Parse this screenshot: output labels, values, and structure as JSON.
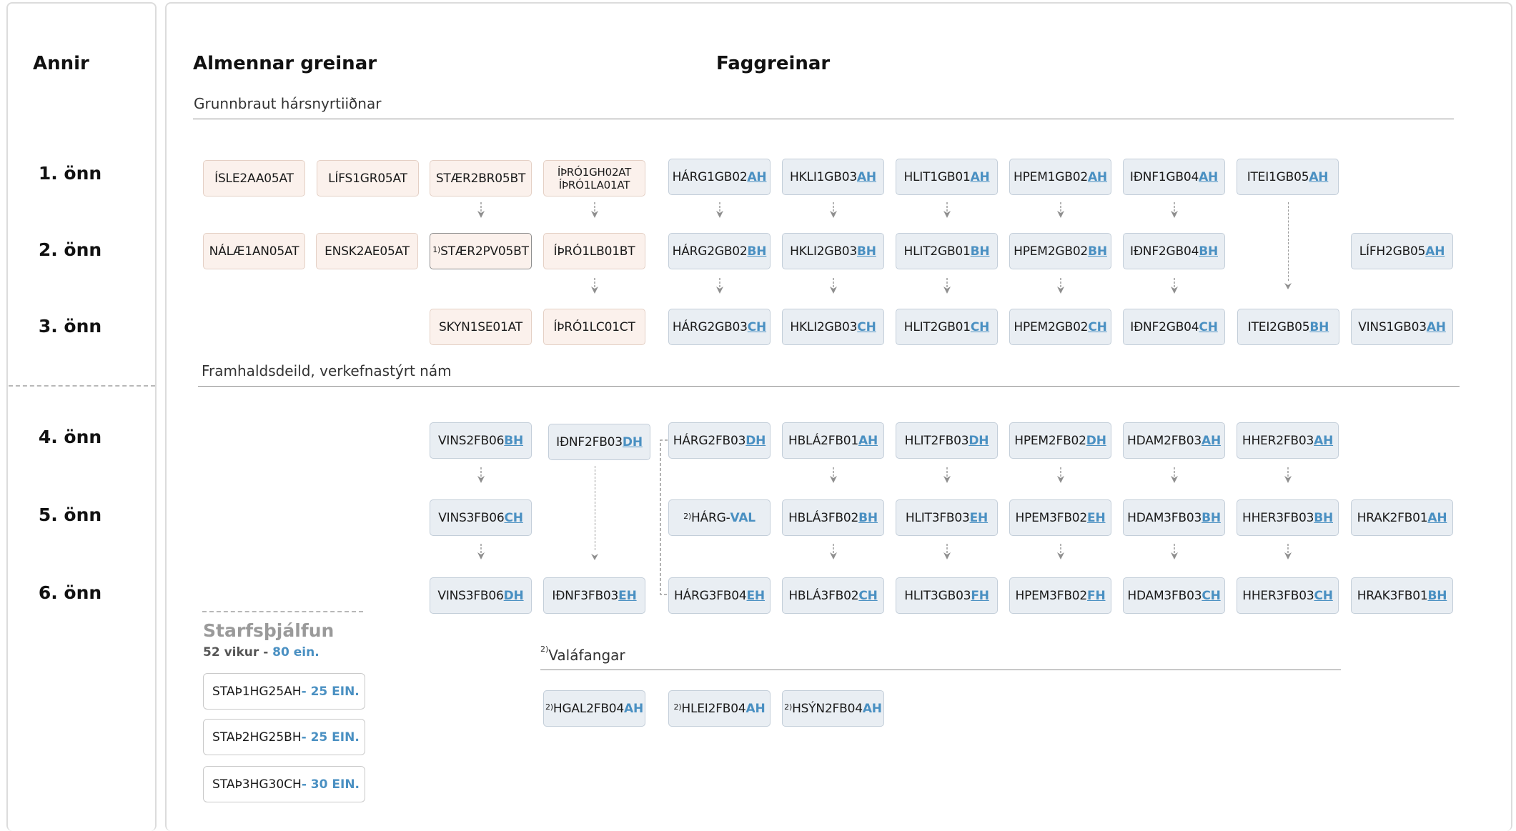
{
  "headers": {
    "annir": "Annir",
    "almennar": "Almennar greinar",
    "faggreinar": "Faggreinar"
  },
  "terms": [
    "1. önn",
    "2. önn",
    "3. önn",
    "4. önn",
    "5. önn",
    "6. önn"
  ],
  "sections": {
    "grunnbraut": "Grunnbraut hársnyrtiiðnar",
    "framhald": "Framhaldsdeild, verkefnastýrt nám",
    "valafangar_sup": "2)",
    "valafangar": "Valáfangar"
  },
  "colors": {
    "accent": "#4a90c2",
    "pink_bg": "#fbf1ec",
    "blue_bg": "#e9eef3"
  },
  "courses": {
    "islenska": "ÍSLE2AA05AT",
    "lifsleikni": "LÍFS1GR05AT",
    "staer1": "STÆR2BR05BT",
    "ithrottir1_a": "ÍÞRÓ1GH02AT",
    "ithrottir1_b": "ÍÞRÓ1LA01AT",
    "harg1_base": "HÁRG1GB02",
    "harg1_sfx": "AH",
    "hkli1_base": "HKLI1GB03",
    "hkli1_sfx": "AH",
    "hlit1_base": "HLIT1GB01",
    "hlit1_sfx": "AH",
    "hpem1_base": "HPEM1GB02",
    "hpem1_sfx": "AH",
    "idnf1_base": "IÐNF1GB04",
    "idnf1_sfx": "AH",
    "itei1_base": "ITEI1GB05",
    "itei1_sfx": "AH",
    "nalae": "NÁLÆ1AN05AT",
    "ensk": "ENSK2AE05AT",
    "staer2_sup": "1)",
    "staer2": "STÆR2PV05BT",
    "ithrottir2": "ÍÞRÓ1LB01BT",
    "harg2_base": "HÁRG2GB02",
    "harg2_sfx": "BH",
    "hkli2_base": "HKLI2GB03",
    "hkli2_sfx": "BH",
    "hlit2_base": "HLIT2GB01",
    "hlit2_sfx": "BH",
    "hpem2_base": "HPEM2GB02",
    "hpem2_sfx": "BH",
    "idnf2_base": "IÐNF2GB04",
    "idnf2_sfx": "BH",
    "lifh_base": "LÍFH2GB05",
    "lifh_sfx": "AH",
    "skyn": "SKYN1SE01AT",
    "ithrottir3": "ÍÞRÓ1LC01CT",
    "harg3_base": "HÁRG2GB03",
    "harg3_sfx": "CH",
    "hkli3_base": "HKLI2GB03",
    "hkli3_sfx": "CH",
    "hlit3_base": "HLIT2GB01",
    "hlit3_sfx": "CH",
    "hpem3_base": "HPEM2GB02",
    "hpem3_sfx": "CH",
    "idnf3_base": "IÐNF2GB04",
    "idnf3_sfx": "CH",
    "itei2_base": "ITEI2GB05",
    "itei2_sfx": "BH",
    "vins1_base": "VINS1GB03",
    "vins1_sfx": "AH",
    "vins4_base": "VINS2FB06",
    "vins4_sfx": "BH",
    "idnf4_base": "IÐNF2FB03",
    "idnf4_sfx": "DH",
    "harg4_base": "HÁRG2FB03",
    "harg4_sfx": "DH",
    "hbla4_base": "HBLÁ2FB01",
    "hbla4_sfx": "AH",
    "hlit4_base": "HLIT2FB03",
    "hlit4_sfx": "DH",
    "hpem4_base": "HPEM2FB02",
    "hpem4_sfx": "DH",
    "hdam4_base": "HDAM2FB03",
    "hdam4_sfx": "AH",
    "hher4_base": "HHER2FB03",
    "hher4_sfx": "AH",
    "vins5_base": "VINS3FB06",
    "vins5_sfx": "CH",
    "hargval_sup": "2)",
    "hargval_base": "HÁRG-",
    "hargval_sfx": "VAL",
    "hbla5_base": "HBLÁ3FB02",
    "hbla5_sfx": "BH",
    "hlit5_base": "HLIT3FB03",
    "hlit5_sfx": "EH",
    "hpem5_base": "HPEM3FB02",
    "hpem5_sfx": "EH",
    "hdam5_base": "HDAM3FB03",
    "hdam5_sfx": "BH",
    "hher5_base": "HHER3FB03",
    "hher5_sfx": "BH",
    "hrak5_base": "HRAK2FB01",
    "hrak5_sfx": "AH",
    "vins6_base": "VINS3FB06",
    "vins6_sfx": "DH",
    "idnf6_base": "IÐNF3FB03",
    "idnf6_sfx": "EH",
    "harg6_base": "HÁRG3FB04",
    "harg6_sfx": "EH",
    "hbla6_base": "HBLÁ3FB02",
    "hbla6_sfx": "CH",
    "hlit6_base": "HLIT3GB03",
    "hlit6_sfx": "FH",
    "hpem6_base": "HPEM3FB02",
    "hpem6_sfx": "FH",
    "hdam6_base": "HDAM3FB03",
    "hdam6_sfx": "CH",
    "hher6_base": "HHER3FB03",
    "hher6_sfx": "CH",
    "hrak6_base": "HRAK3FB01",
    "hrak6_sfx": "BH",
    "hgal_sup": "2)",
    "hgal_base": "HGAL2FB04",
    "hgal_sfx": "AH",
    "hlei_sup": "2)",
    "hlei_base": "HLEI2FB04",
    "hlei_sfx": "AH",
    "hsyn_sup": "2)",
    "hsyn_base": "HSÝN2FB04",
    "hsyn_sfx": "AH"
  },
  "starfsthjalfun": {
    "title": "Starfsþjálfun",
    "weeks": "52 vikur - ",
    "units": "80 ein.",
    "items": [
      {
        "code": "STAÞ1HG25AH",
        "units": " - 25 EIN."
      },
      {
        "code": "STAÞ2HG25BH",
        "units": " - 25 EIN."
      },
      {
        "code": "STAÞ3HG30CH",
        "units": " - 30 EIN."
      }
    ]
  }
}
